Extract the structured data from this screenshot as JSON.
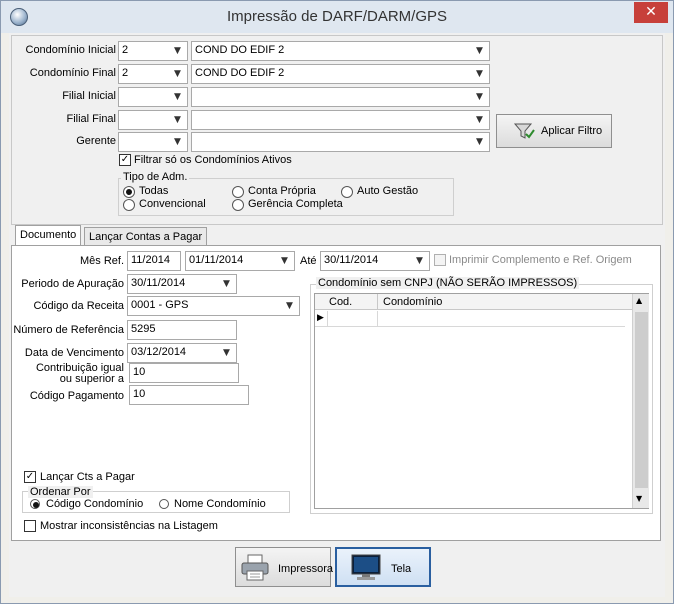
{
  "window": {
    "title": "Impressão de DARF/DARM/GPS",
    "close_glyph": "✕"
  },
  "filters": {
    "condominio_inicial": {
      "label": "Condomínio Inicial",
      "code": "2",
      "name": "COND DO EDIF 2"
    },
    "condominio_final": {
      "label": "Condomínio Final",
      "code": "2",
      "name": "COND DO EDIF 2"
    },
    "filial_inicial": {
      "label": "Filial Inicial",
      "code": "",
      "name": ""
    },
    "filial_final": {
      "label": "Filial Final",
      "code": "",
      "name": ""
    },
    "gerente": {
      "label": "Gerente",
      "code": "",
      "name": ""
    },
    "ativos_label": "Filtrar só os Condomínios Ativos",
    "apply_button": "Aplicar Filtro"
  },
  "tipo_adm": {
    "title": "Tipo de Adm.",
    "options": [
      "Todas",
      "Conta Própria",
      "Auto Gestão",
      "Convencional",
      "Gerência Completa"
    ],
    "selected": "Todas"
  },
  "tabs": [
    "Documento",
    "Lançar Contas a Pagar"
  ],
  "documento": {
    "mes_ref_label": "Mês Ref.",
    "mes_ref": "11/2014",
    "data_de": "01/11/2014",
    "ate_label": "Até",
    "data_ate": "30/11/2014",
    "imprimir_label": "Imprimir Complemento e Ref. Origem",
    "periodo_label": "Periodo de Apuração",
    "periodo": "30/11/2014",
    "codigo_receita_label": "Código da Receita",
    "codigo_receita": "0001 - GPS",
    "numero_referencia_label": "Número de Referência",
    "numero_referencia": "5295",
    "data_vencimento_label": "Data de Vencimento",
    "data_vencimento": "03/12/2014",
    "contribuicao_label_1": "Contribuição igual",
    "contribuicao_label_2": "ou superior a",
    "contribuicao": "10",
    "codigo_pagamento_label": "Código Pagamento",
    "codigo_pagamento": "10",
    "lancar_label": "Lançar Cts a Pagar",
    "ordenar_title": "Ordenar Por",
    "ordenar_options": [
      "Código Condomínio",
      "Nome Condomínio"
    ],
    "ordenar_selected": "Código Condomínio",
    "mostrar_label": "Mostrar inconsistências na Listagem"
  },
  "grid": {
    "title": "Condomínio sem CNPJ (NÃO SERÃO IMPRESSOS)",
    "columns": [
      "Cod.",
      "Condomínio"
    ],
    "row_marker": "▶"
  },
  "actions": {
    "impressora": "Impressora",
    "tela": "Tela"
  },
  "icons": {
    "combo_arrow": "chevron-down-icon",
    "filter": "funnel-icon",
    "printer": "printer-icon",
    "screen": "monitor-icon"
  }
}
